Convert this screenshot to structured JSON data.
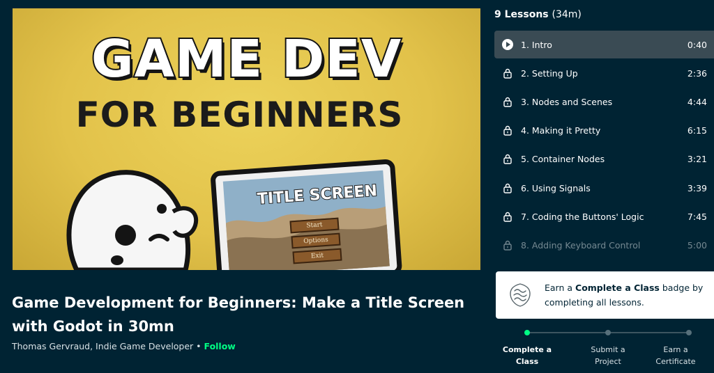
{
  "video": {
    "thumb_line1": "GAME DEV",
    "thumb_line2": "FOR BEGINNERS",
    "screen_title": "TITLE SCREEN",
    "menu_buttons": [
      "Start",
      "Options",
      "Exit"
    ]
  },
  "class_info": {
    "title": "Game Development for Beginners: Make a Title Screen with Godot in 30mn",
    "author": "Thomas Gervraud, Indie Game Developer",
    "separator": " • ",
    "follow": "Follow"
  },
  "lessons": {
    "count_label": "9 Lessons",
    "total_duration": "(34m)",
    "items": [
      {
        "label": "1. Intro",
        "time": "0:40",
        "icon": "play-icon"
      },
      {
        "label": "2. Setting Up",
        "time": "2:36",
        "icon": "lock-icon"
      },
      {
        "label": "3. Nodes and Scenes",
        "time": "4:44",
        "icon": "lock-icon"
      },
      {
        "label": "4. Making it Pretty",
        "time": "6:15",
        "icon": "lock-icon"
      },
      {
        "label": "5. Container Nodes",
        "time": "3:21",
        "icon": "lock-icon"
      },
      {
        "label": "6. Using Signals",
        "time": "3:39",
        "icon": "lock-icon"
      },
      {
        "label": "7. Coding the Buttons' Logic",
        "time": "7:45",
        "icon": "lock-icon"
      },
      {
        "label": "8. Adding Keyboard Control",
        "time": "5:00",
        "icon": "lock-icon"
      }
    ]
  },
  "badge": {
    "prefix": "Earn a ",
    "highlight": "Complete a Class",
    "suffix": " badge by completing all lessons."
  },
  "steps": [
    {
      "line1": "Complete a",
      "line2": "Class"
    },
    {
      "line1": "Submit a",
      "line2": "Project"
    },
    {
      "line1": "Earn a",
      "line2": "Certificate"
    }
  ],
  "colors": {
    "background": "#002333",
    "accent_green": "#00ff84",
    "active_row": "#3a4b54"
  }
}
